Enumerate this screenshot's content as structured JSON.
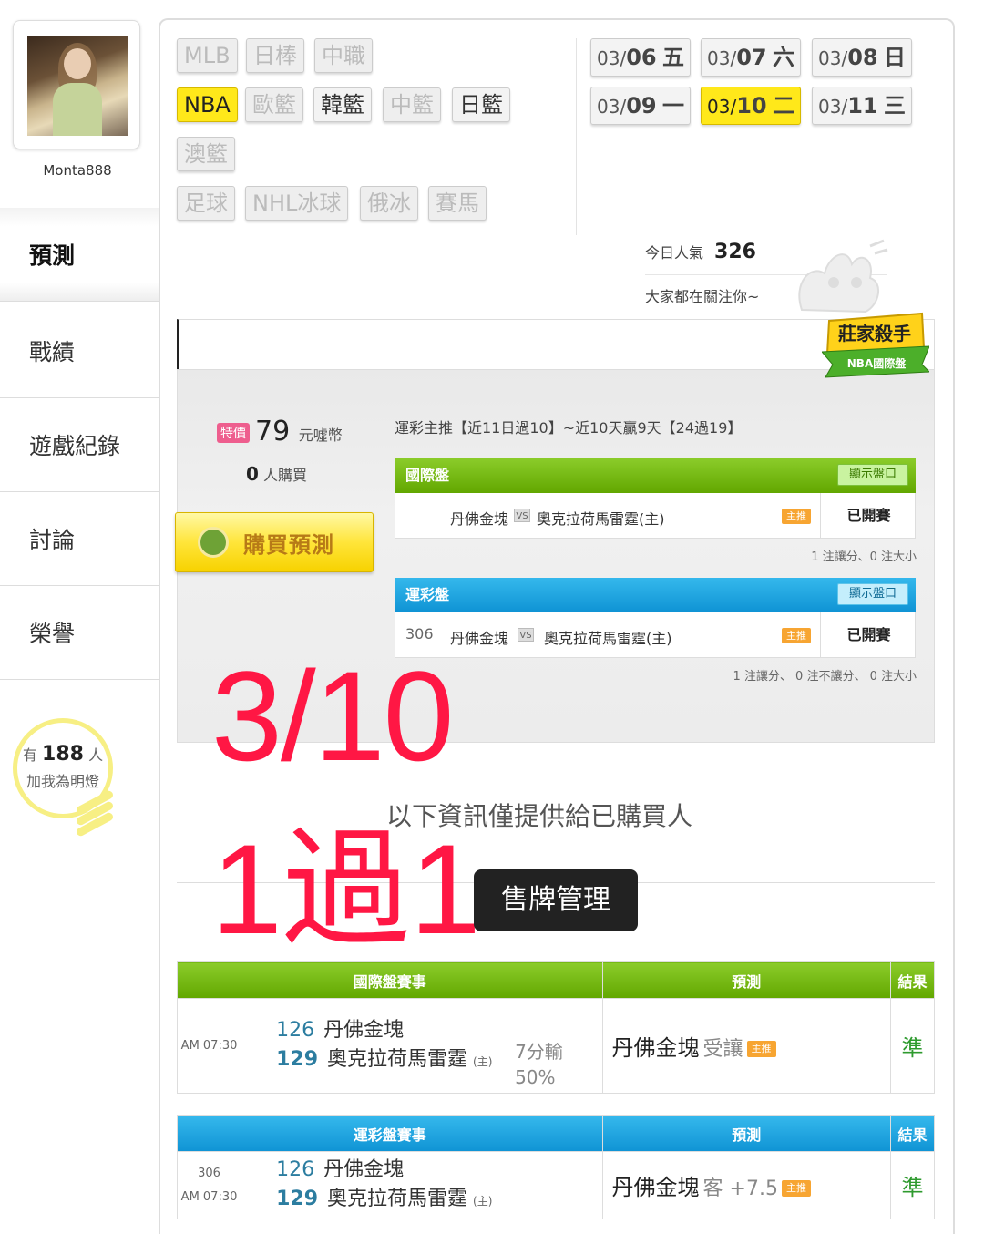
{
  "user": {
    "name": "Monta888"
  },
  "nav": [
    "預測",
    "戰績",
    "遊戲紀錄",
    "討論",
    "榮譽"
  ],
  "fans": {
    "prefix": "有",
    "count": "188",
    "suffix": "人",
    "line2": "加我為明燈"
  },
  "sports": [
    "MLB",
    "日棒",
    "中職",
    "NBA",
    "歐籃",
    "韓籃",
    "中籃",
    "日籃",
    "澳籃",
    "足球",
    "NHL冰球",
    "俄冰",
    "賽馬"
  ],
  "dates": [
    {
      "m": "03/",
      "d": "06",
      "w": "五"
    },
    {
      "m": "03/",
      "d": "07",
      "w": "六"
    },
    {
      "m": "03/",
      "d": "08",
      "w": "日"
    },
    {
      "m": "03/",
      "d": "09",
      "w": "一"
    },
    {
      "m": "03/",
      "d": "10",
      "w": "二"
    },
    {
      "m": "03/",
      "d": "11",
      "w": "三"
    }
  ],
  "popularity": {
    "label": "今日人氣",
    "value": "326",
    "sub": "大家都在關注你~"
  },
  "badge": {
    "title": "莊家殺手",
    "sub": "NBA國際盤"
  },
  "offer": {
    "tag": "特價",
    "price": "79",
    "unit": "元噓幣",
    "buyers": "0",
    "buyers_unit": "人購買",
    "buy_label": "購買預測",
    "coin_text": "噓",
    "recommend": "運彩主推【近11日過10】~近10天贏9天【24過19】"
  },
  "markets": [
    {
      "title": "國際盤",
      "show_label": "顯示盤口",
      "code": "",
      "team1": "丹佛金塊",
      "vs": "VS",
      "team2": "奧克拉荷馬雷霆(主)",
      "host_tag": "主推",
      "status": "已開賽",
      "note": "1 注讓分、0 注大小"
    },
    {
      "title": "運彩盤",
      "show_label": "顯示盤口",
      "code": "306",
      "team1": "丹佛金塊",
      "vs": "VS",
      "team2": "奧克拉荷馬雷霆(主)",
      "host_tag": "主推",
      "status": "已開賽",
      "note": "1 注讓分、 0 注不讓分、 0 注大小"
    }
  ],
  "overlay": {
    "date": "3/10",
    "record": "1過1",
    "info": "以下資訊僅提供給已購買人",
    "toast": "售牌管理"
  },
  "results": [
    {
      "header": [
        "國際盤賽事",
        "預測",
        "結果"
      ],
      "code": "",
      "time": "AM 07:30",
      "team1_no": "126",
      "team1": "丹佛金塊",
      "team2_no": "129",
      "team2": "奧克拉荷馬雷霆",
      "home_tag": "(主)",
      "extra1": "7分輸",
      "extra2": "50%",
      "pred_team": "丹佛金塊",
      "pred_tag": "受讓",
      "pred_host": "主推",
      "result": "準"
    },
    {
      "header": [
        "運彩盤賽事",
        "預測",
        "結果"
      ],
      "code": "306",
      "time": "AM 07:30",
      "team1_no": "126",
      "team1": "丹佛金塊",
      "team2_no": "129",
      "team2": "奧克拉荷馬雷霆",
      "home_tag": "(主)",
      "extra1": "",
      "extra2": "",
      "pred_team": "丹佛金塊",
      "pred_tag": "客 +7.5",
      "pred_host": "主推",
      "result": "準"
    }
  ]
}
